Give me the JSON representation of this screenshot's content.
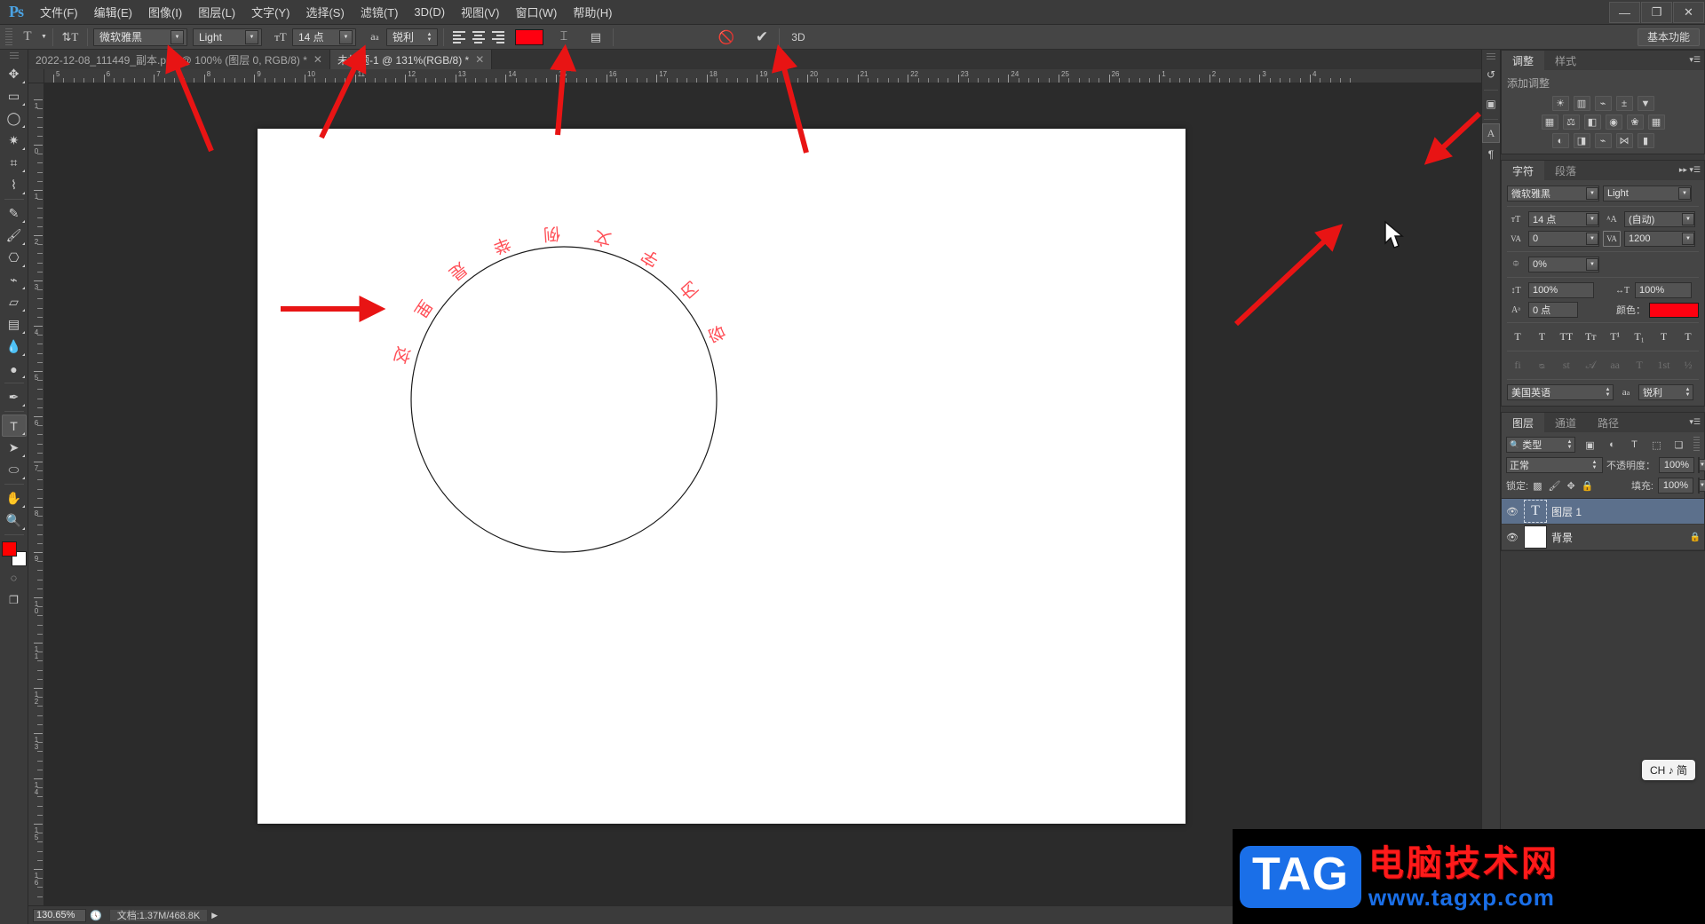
{
  "app": {
    "name": "Ps",
    "logo": "Ps"
  },
  "menubar": {
    "items": [
      {
        "label": "文件(F)"
      },
      {
        "label": "编辑(E)"
      },
      {
        "label": "图像(I)"
      },
      {
        "label": "图层(L)"
      },
      {
        "label": "文字(Y)"
      },
      {
        "label": "选择(S)"
      },
      {
        "label": "滤镜(T)"
      },
      {
        "label": "3D(D)"
      },
      {
        "label": "视图(V)"
      },
      {
        "label": "窗口(W)"
      },
      {
        "label": "帮助(H)"
      }
    ],
    "window_controls": {
      "minimize": "—",
      "restore": "❐",
      "close": "✕"
    }
  },
  "optionsbar": {
    "tool_preset": "T",
    "text_orientation_icon": "toggle-text-orientation",
    "font_family": "微软雅黑",
    "font_style": "Light",
    "font_size": "14 点",
    "antialias_label": "aa",
    "antialias_value": "锐利",
    "align": [
      "align-left",
      "align-center",
      "align-right"
    ],
    "color_hex": "#ff0010",
    "warp_text_icon": "warp-text",
    "panels_icon": "toggle-character-panel",
    "cancel_icon": "cancel-edit",
    "commit_icon": "commit-edit",
    "threed_label": "3D",
    "workspace": "基本功能"
  },
  "toolbox": {
    "tools": [
      {
        "name": "move-tool",
        "glyph": "✥"
      },
      {
        "name": "marquee-tool",
        "glyph": "▭"
      },
      {
        "name": "lasso-tool",
        "glyph": "◯"
      },
      {
        "name": "quick-selection-tool",
        "glyph": "✷"
      },
      {
        "name": "crop-tool",
        "glyph": "⌗"
      },
      {
        "name": "eyedropper-tool",
        "glyph": "⌇"
      },
      {
        "name": "spot-healing-brush-tool",
        "glyph": "✎"
      },
      {
        "name": "brush-tool",
        "glyph": "🖌"
      },
      {
        "name": "clone-stamp-tool",
        "glyph": "⎔"
      },
      {
        "name": "history-brush-tool",
        "glyph": "⌁"
      },
      {
        "name": "eraser-tool",
        "glyph": "▱"
      },
      {
        "name": "gradient-tool",
        "glyph": "▤"
      },
      {
        "name": "blur-tool",
        "glyph": "💧"
      },
      {
        "name": "dodge-tool",
        "glyph": "●"
      },
      {
        "name": "pen-tool",
        "glyph": "✒"
      },
      {
        "name": "type-tool",
        "glyph": "T",
        "active": true
      },
      {
        "name": "path-selection-tool",
        "glyph": "➤"
      },
      {
        "name": "ellipse-shape-tool",
        "glyph": "⬭"
      },
      {
        "name": "hand-tool",
        "glyph": "✋"
      },
      {
        "name": "zoom-tool",
        "glyph": "🔍"
      }
    ],
    "foreground_color": "#ff0000",
    "background_color": "#ffffff",
    "quickmask_icon": "quick-mask-mode",
    "screenmode_icon": "screen-mode"
  },
  "documents": {
    "tabs": [
      {
        "label": "2022-12-08_111449_副本.png @ 100% (图层 0, RGB/8) *",
        "active": false,
        "close": "✕"
      },
      {
        "label": "未标题-1 @ 131%(RGB/8) *",
        "active": true,
        "close": "✕"
      }
    ]
  },
  "rulers": {
    "horizontal": [
      "5",
      "6",
      "7",
      "8",
      "9",
      "10",
      "11",
      "12",
      "13",
      "14",
      "15",
      "16",
      "17",
      "18",
      "19",
      "20",
      "21",
      "22",
      "23",
      "24",
      "25",
      "26",
      "1",
      "2",
      "3",
      "4"
    ],
    "vertical": [
      "1",
      "0",
      "1",
      "2",
      "3",
      "4",
      "5",
      "6",
      "7",
      "8",
      "9",
      "1 0",
      "1 1",
      "1 2",
      "1 3",
      "1 4",
      "1 5",
      "1 6"
    ]
  },
  "canvas": {
    "circle_text": "这里是举例文字内容",
    "text_color": "#ff4d55",
    "path_stroke": "#1a1a1a"
  },
  "adjustments_panel": {
    "tabs": [
      {
        "label": "调整",
        "active": true
      },
      {
        "label": "样式",
        "active": false
      }
    ],
    "title": "添加调整",
    "rows": [
      [
        {
          "name": "brightness-contrast-icon",
          "glyph": "☀"
        },
        {
          "name": "levels-icon",
          "glyph": "▥"
        },
        {
          "name": "curves-icon",
          "glyph": "⌁"
        },
        {
          "name": "exposure-icon",
          "glyph": "±"
        },
        {
          "name": "vibrance-icon",
          "glyph": "▼"
        }
      ],
      [
        {
          "name": "hue-saturation-icon",
          "glyph": "▦"
        },
        {
          "name": "color-balance-icon",
          "glyph": "⚖"
        },
        {
          "name": "black-white-icon",
          "glyph": "◧"
        },
        {
          "name": "photo-filter-icon",
          "glyph": "◉"
        },
        {
          "name": "channel-mixer-icon",
          "glyph": "❀"
        },
        {
          "name": "color-lookup-icon",
          "glyph": "▦"
        }
      ],
      [
        {
          "name": "invert-icon",
          "glyph": "◐"
        },
        {
          "name": "posterize-icon",
          "glyph": "◨"
        },
        {
          "name": "threshold-icon",
          "glyph": "⌁"
        },
        {
          "name": "selective-color-icon",
          "glyph": "⋈"
        },
        {
          "name": "gradient-map-icon",
          "glyph": "▮"
        }
      ]
    ]
  },
  "character_panel": {
    "tabs": [
      {
        "label": "字符",
        "active": true
      },
      {
        "label": "段落",
        "active": false
      }
    ],
    "font_family": "微软雅黑",
    "font_style": "Light",
    "font_size_icon": "font-size-icon",
    "font_size": "14 点",
    "leading_icon": "leading-icon",
    "leading": "(自动)",
    "kerning_icon": "kerning-icon",
    "kerning": "0",
    "tracking_icon": "tracking-icon",
    "tracking": "1200",
    "vertical_scale_icon": "vertical-scale-icon",
    "vertical_scale": "100%",
    "horizontal_scale_icon": "horizontal-scale-icon",
    "horizontal_scale": "100%",
    "ratio_icon": "proportional-metrics-icon",
    "ratio": "0%",
    "baseline_icon": "baseline-shift-icon",
    "baseline": "0 点",
    "color_label": "颜色：",
    "color_hex": "#ff0010",
    "style_row1": [
      {
        "name": "faux-bold-button",
        "glyph": "T"
      },
      {
        "name": "faux-italic-button",
        "glyph": "T"
      },
      {
        "name": "all-caps-button",
        "glyph": "TT"
      },
      {
        "name": "small-caps-button",
        "glyph": "Tᴛ"
      },
      {
        "name": "superscript-button",
        "glyph": "T¹"
      },
      {
        "name": "subscript-button",
        "glyph": "T₁"
      },
      {
        "name": "underline-button",
        "glyph": "T"
      },
      {
        "name": "strikethrough-button",
        "glyph": "T"
      }
    ],
    "style_row2": [
      {
        "name": "standard-ligatures-button",
        "glyph": "fi"
      },
      {
        "name": "discretionary-ligatures-button",
        "glyph": "ᴓ"
      },
      {
        "name": "contextual-alternates-button",
        "glyph": "st"
      },
      {
        "name": "swash-button",
        "glyph": "𝒜"
      },
      {
        "name": "stylistic-alternates-button",
        "glyph": "aa"
      },
      {
        "name": "titling-alternates-button",
        "glyph": "T"
      },
      {
        "name": "ordinals-button",
        "glyph": "1st"
      },
      {
        "name": "fractions-button",
        "glyph": "½"
      }
    ],
    "language": "美国英语",
    "antialias_icon": "aa",
    "antialias": "锐利"
  },
  "layers_panel": {
    "tabs": [
      {
        "label": "图层",
        "active": true
      },
      {
        "label": "通道",
        "active": false
      },
      {
        "label": "路径",
        "active": false
      }
    ],
    "filter_label": "类型",
    "filter_icons": [
      {
        "name": "filter-pixel-icon",
        "glyph": "▣"
      },
      {
        "name": "filter-adjustment-icon",
        "glyph": "◐"
      },
      {
        "name": "filter-type-icon",
        "glyph": "T"
      },
      {
        "name": "filter-shape-icon",
        "glyph": "⬚"
      },
      {
        "name": "filter-smart-object-icon",
        "glyph": "❏"
      }
    ],
    "blend_mode": "正常",
    "opacity_label": "不透明度：",
    "opacity_value": "100%",
    "lock_label": "锁定:",
    "lock_icons": [
      {
        "name": "lock-transparent-pixels-icon",
        "glyph": "▩"
      },
      {
        "name": "lock-image-pixels-icon",
        "glyph": "🖌"
      },
      {
        "name": "lock-position-icon",
        "glyph": "✥"
      },
      {
        "name": "lock-all-icon",
        "glyph": "🔒"
      }
    ],
    "fill_label": "填充:",
    "fill_value": "100%",
    "layers": [
      {
        "name": "图层 1",
        "thumb_type": "text",
        "thumb_glyph": "T",
        "selected": true,
        "visible": "👁",
        "locked": false
      },
      {
        "name": "背景",
        "thumb_type": "solid",
        "thumb_glyph": "",
        "selected": false,
        "visible": "👁",
        "locked": true,
        "lock_glyph": "🔒"
      }
    ]
  },
  "statusbar": {
    "zoom": "130.65%",
    "doc_info": "文档:1.37M/468.8K",
    "arrow": "▶"
  },
  "ime_indicator": {
    "text": "CH ♪ 简"
  },
  "watermark": {
    "tag": "TAG",
    "site_cn": "电脑技术网",
    "url": "www.tagxp.com"
  },
  "annotations": {
    "arrow_color": "#e81414",
    "arrow_count": 6,
    "cursor": "pointer-cursor"
  }
}
